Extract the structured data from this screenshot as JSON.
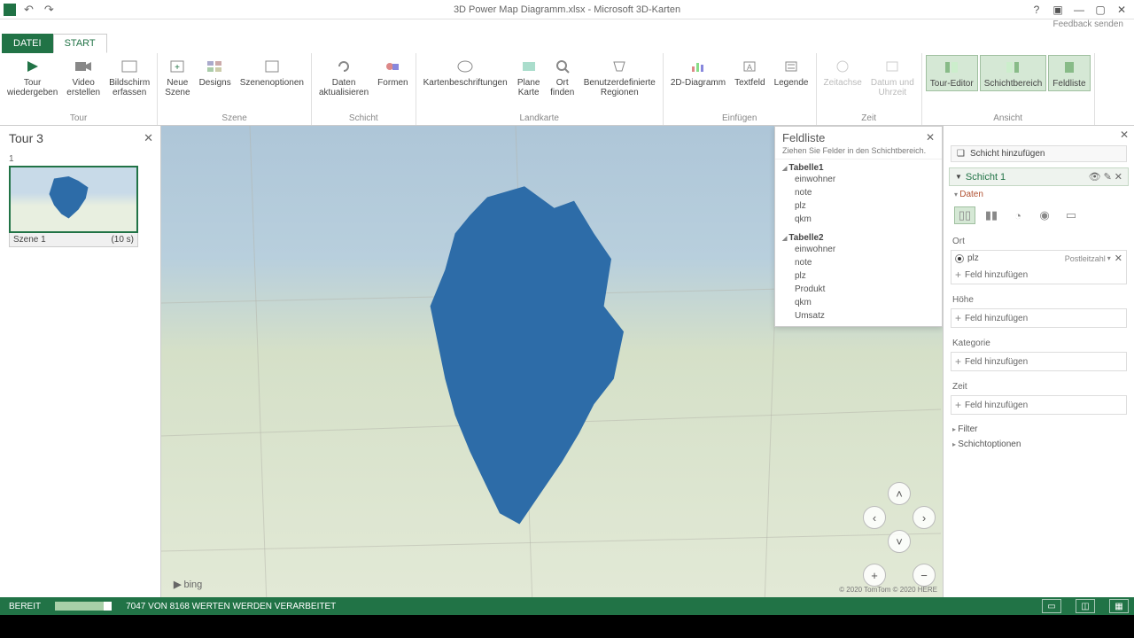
{
  "titlebar": {
    "title": "3D Power Map Diagramm.xlsx - Microsoft 3D-Karten"
  },
  "feedback": "Feedback senden",
  "tabs": {
    "file": "DATEI",
    "start": "START"
  },
  "ribbon": {
    "tour": {
      "label": "Tour",
      "play": "Tour\nwiedergeben",
      "video": "Video\nerstellen",
      "screen": "Bildschirm\nerfassen"
    },
    "scene": {
      "label": "Szene",
      "new": "Neue\nSzene",
      "designs": "Designs",
      "options": "Szenenoptionen"
    },
    "layer": {
      "label": "Schicht",
      "refresh": "Daten\naktualisieren",
      "shapes": "Formen"
    },
    "map": {
      "label": "Landkarte",
      "labels": "Kartenbeschriftungen",
      "flat": "Plane\nKarte",
      "find": "Ort\nfinden",
      "custom": "Benutzerdefinierte\nRegionen"
    },
    "insert": {
      "label": "Einfügen",
      "chart2d": "2D-Diagramm",
      "textbox": "Textfeld",
      "legend": "Legende"
    },
    "time": {
      "label": "Zeit",
      "timeline": "Zeitachse",
      "datetime": "Datum und\nUhrzeit"
    },
    "view": {
      "label": "Ansicht",
      "toureditor": "Tour-Editor",
      "layerpane": "Schichtbereich",
      "fieldlist": "Feldliste"
    }
  },
  "tourpanel": {
    "title": "Tour 3",
    "scene_num": "1",
    "scene_name": "Szene 1",
    "scene_time": "(10 s)"
  },
  "map": {
    "bing": "bing",
    "copyright": "© 2020 TomTom © 2020 HERE"
  },
  "fieldlist": {
    "title": "Feldliste",
    "instruction": "Ziehen Sie Felder in den Schichtbereich.",
    "tables": [
      {
        "name": "Tabelle1",
        "fields": [
          "einwohner",
          "note",
          "plz",
          "qkm"
        ]
      },
      {
        "name": "Tabelle2",
        "fields": [
          "einwohner",
          "note",
          "plz",
          "Produkt",
          "qkm",
          "Umsatz"
        ]
      }
    ]
  },
  "rightpanel": {
    "addlayer": "Schicht hinzufügen",
    "layer_name": "Schicht 1",
    "daten": "Daten",
    "ort": {
      "label": "Ort",
      "field": "plz",
      "type": "Postleitzahl"
    },
    "addfield": "Feld hinzufügen",
    "hoehe": "Höhe",
    "kategorie": "Kategorie",
    "zeit": "Zeit",
    "filter": "Filter",
    "schichtoptionen": "Schichtoptionen"
  },
  "status": {
    "ready": "BEREIT",
    "progress": "7047 VON 8168 WERTEN WERDEN VERARBEITET"
  }
}
